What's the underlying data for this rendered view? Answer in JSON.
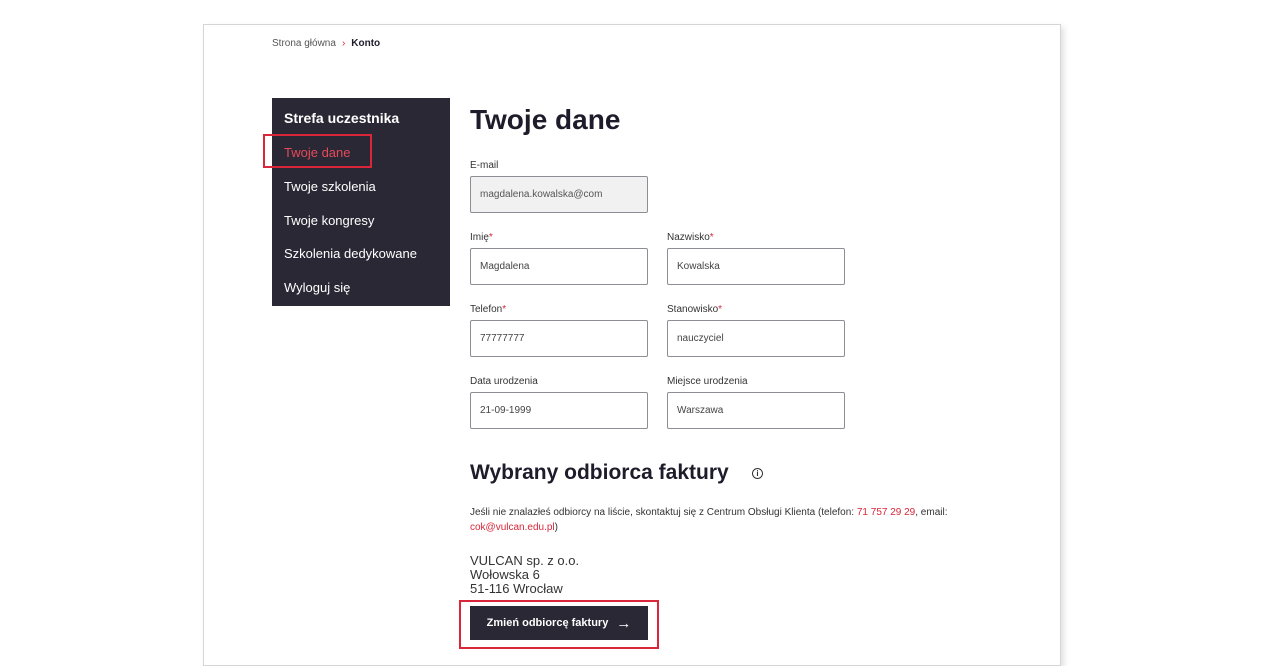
{
  "breadcrumb": {
    "home": "Strona główna",
    "separator": "›",
    "current": "Konto"
  },
  "sidebar": {
    "heading": "Strefa uczestnika",
    "items": [
      {
        "label": "Twoje dane",
        "active": true
      },
      {
        "label": "Twoje szkolenia"
      },
      {
        "label": "Twoje kongresy"
      },
      {
        "label": "Szkolenia dedykowane"
      },
      {
        "label": "Wyloguj się"
      }
    ]
  },
  "form": {
    "title": "Twoje dane",
    "email": {
      "label": "E-mail",
      "value": "magdalena.kowalska@com"
    },
    "first_name": {
      "label": "Imię",
      "required": "*",
      "value": "Magdalena"
    },
    "last_name": {
      "label": "Nazwisko",
      "required": "*",
      "value": "Kowalska"
    },
    "phone": {
      "label": "Telefon",
      "required": "*",
      "value": "77777777"
    },
    "position": {
      "label": "Stanowisko",
      "required": "*",
      "value": "nauczyciel"
    },
    "birth_date": {
      "label": "Data urodzenia",
      "value": "21-09-1999"
    },
    "birth_place": {
      "label": "Miejsce urodzenia",
      "value": "Warszawa"
    }
  },
  "invoice": {
    "title": "Wybrany odbiorca faktury",
    "info_icon": "info-icon",
    "note_prefix": "Jeśli nie znalazłeś odbiorcy na liście, skontaktuj się z Centrum Obsługi Klienta (telefon: ",
    "note_phone": "71 757 29 29",
    "note_middle": ", email: ",
    "note_email": "cok@vulcan.edu.pl",
    "note_suffix": ")",
    "recipient": {
      "name": "VULCAN sp. z o.o.",
      "street": "Wołowska 6",
      "city": "51-116 Wrocław"
    },
    "change_button": "Zmień odbiorcę faktury",
    "change_icon": "arrow-right-icon"
  },
  "colors": {
    "accent": "#d9263a",
    "dark": "#2a2834"
  }
}
